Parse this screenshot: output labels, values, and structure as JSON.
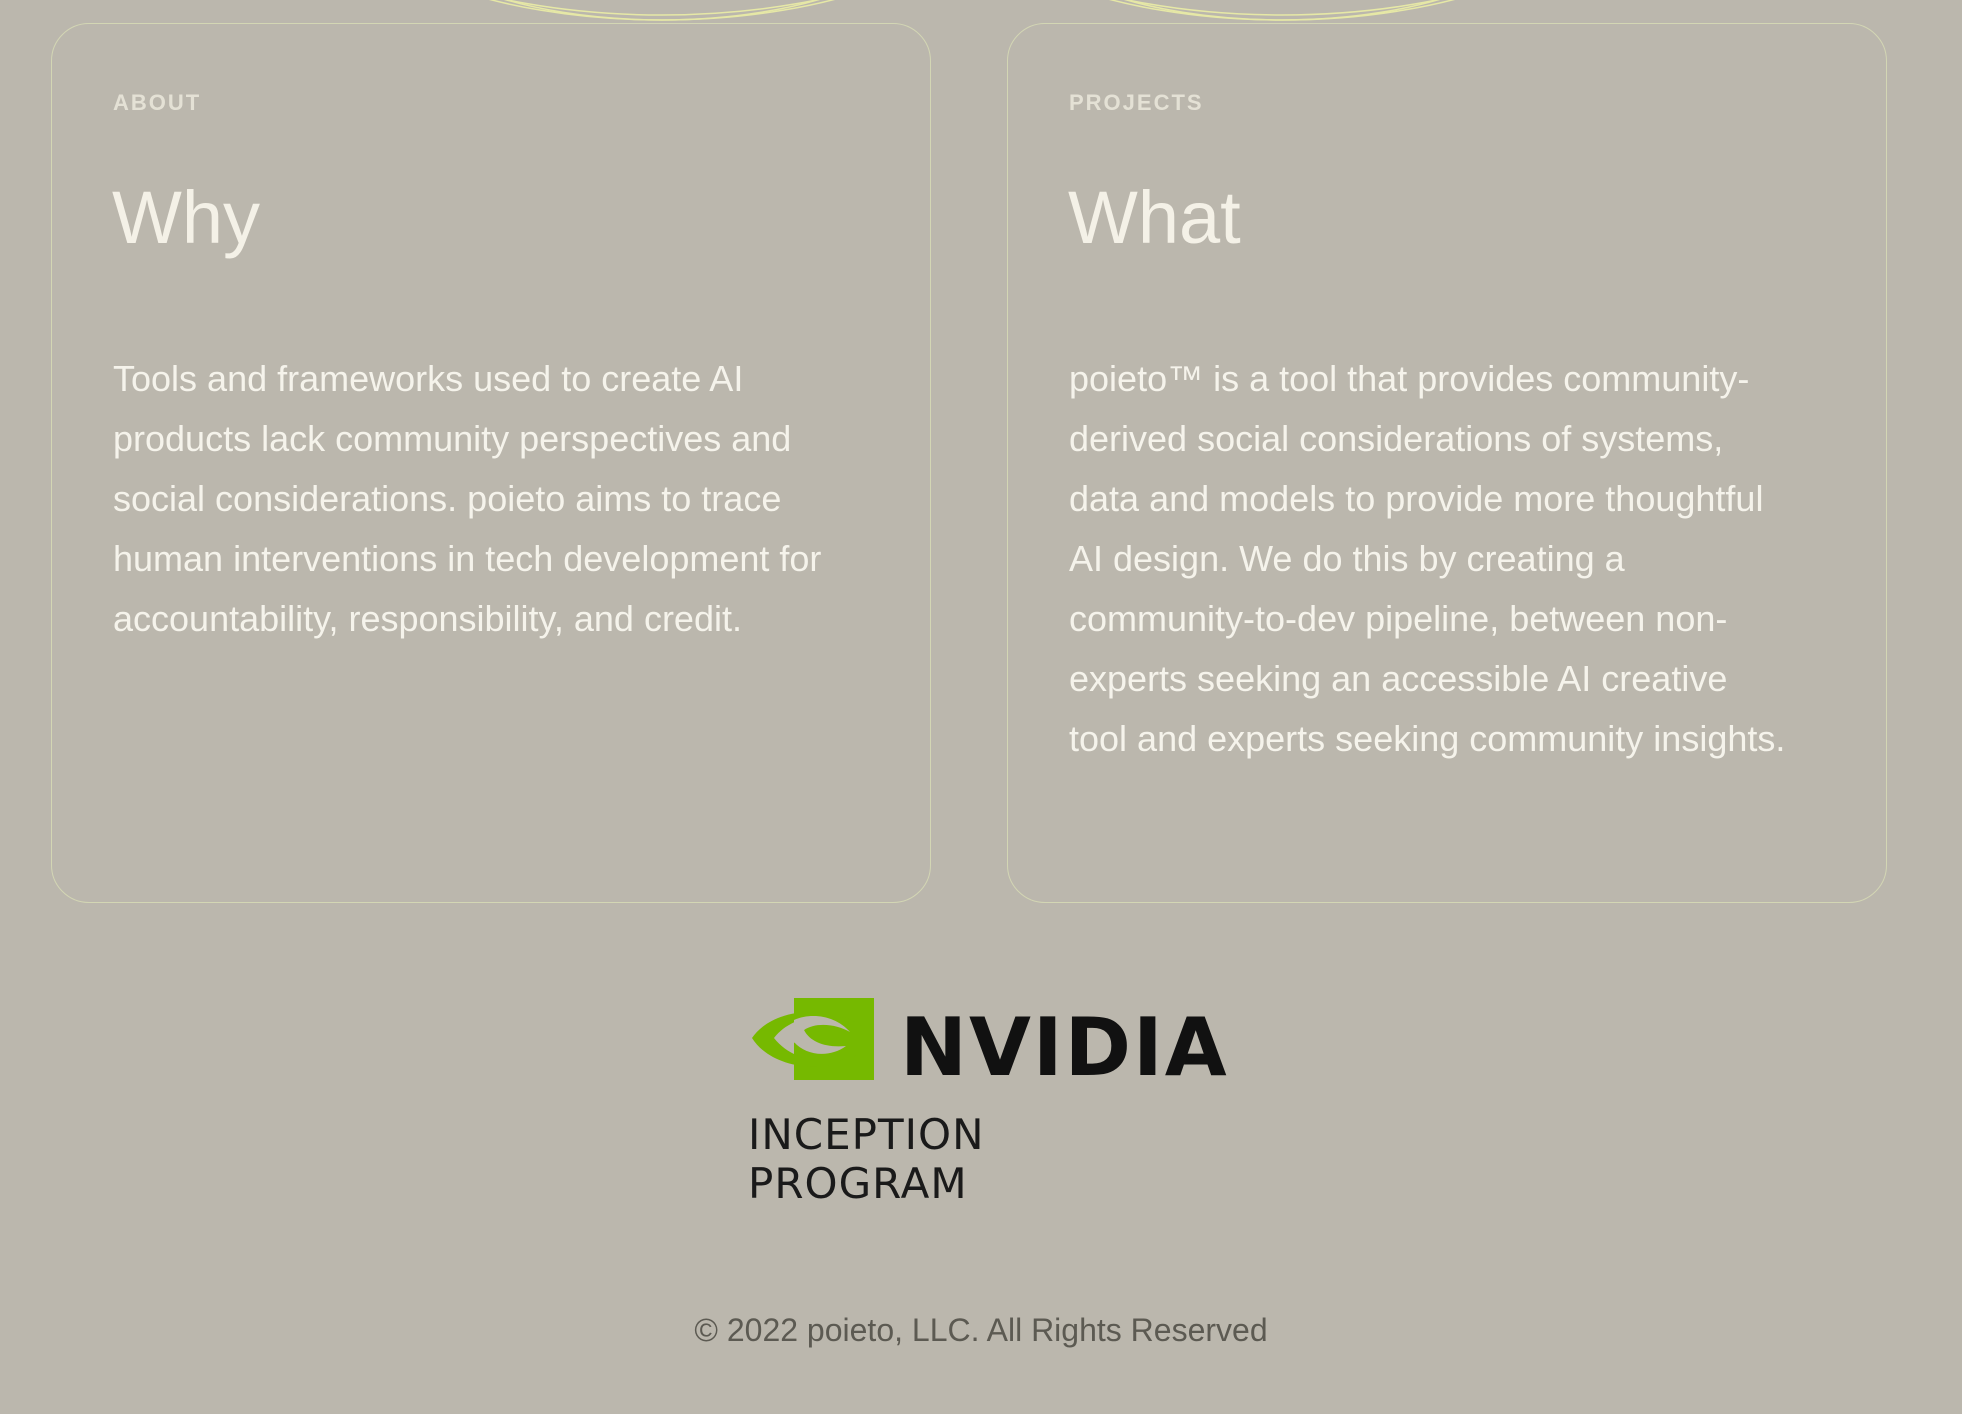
{
  "about": {
    "eyebrow": "ABOUT",
    "title": "Why",
    "body": "Tools and frameworks used to create AI products lack community perspectives and social considerations. poieto aims to trace human interventions in tech development for accountability, responsibility, and credit."
  },
  "projects": {
    "eyebrow": "PROJECTS",
    "title": "What",
    "body": "poieto™ is a tool that provides community-derived social considerations of systems, data and models to provide more thoughtful AI design. We do this by creating a community-to-dev pipeline, between non-experts seeking an accessible AI creative tool and experts seeking community insights."
  },
  "sponsor": {
    "logo_text": "NVIDIA",
    "registered_mark": "®",
    "program": "INCEPTION PROGRAM",
    "logo_icon": "nvidia-eye-icon",
    "brand_color": "#76b900"
  },
  "footer": {
    "copyright": "© 2022 poieto, LLC. All Rights Reserved"
  },
  "colors": {
    "background": "#bbb7ad",
    "card_border": "#d3d6b4",
    "text_light": "#f5f3eb",
    "footer_text": "#5c5a52"
  }
}
